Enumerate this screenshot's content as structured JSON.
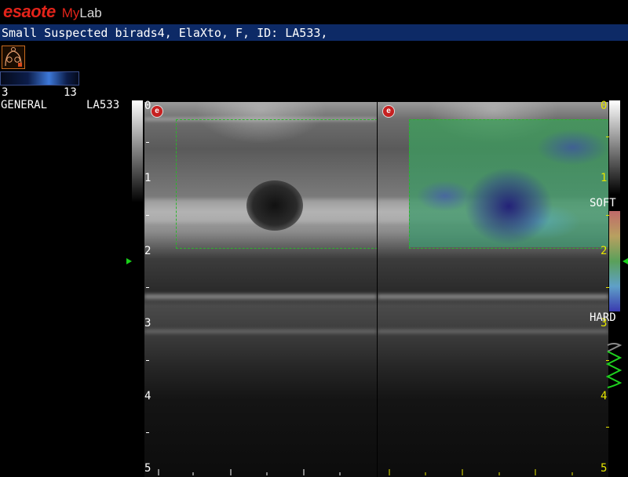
{
  "header": {
    "brand_esaote": "esaote",
    "brand_my": "My",
    "brand_lab": "Lab",
    "patient_info": "Small Suspected birads4, ElaXto, F, ID: LA533,"
  },
  "left_panel": {
    "range_min": "3",
    "range_max": "13",
    "preset": "GENERAL",
    "probe": "LA533"
  },
  "depth_scale": {
    "labels": [
      "0",
      "1",
      "2",
      "3",
      "4",
      "5"
    ]
  },
  "elasto_scale": {
    "soft_label": "SOFT",
    "hard_label": "HARD"
  },
  "logo_glyph": "e",
  "colors": {
    "brand_red": "#e2231a",
    "patient_bar": "#0d2a66",
    "roi_outline": "#2bb52b",
    "depth_yellow": "#e6e600",
    "focus_green": "#19d019"
  },
  "icons": [
    "breast-body-marker-icon",
    "esaote-e-logo-icon",
    "focus-marker-icon",
    "probe-quality-wave-icon"
  ]
}
